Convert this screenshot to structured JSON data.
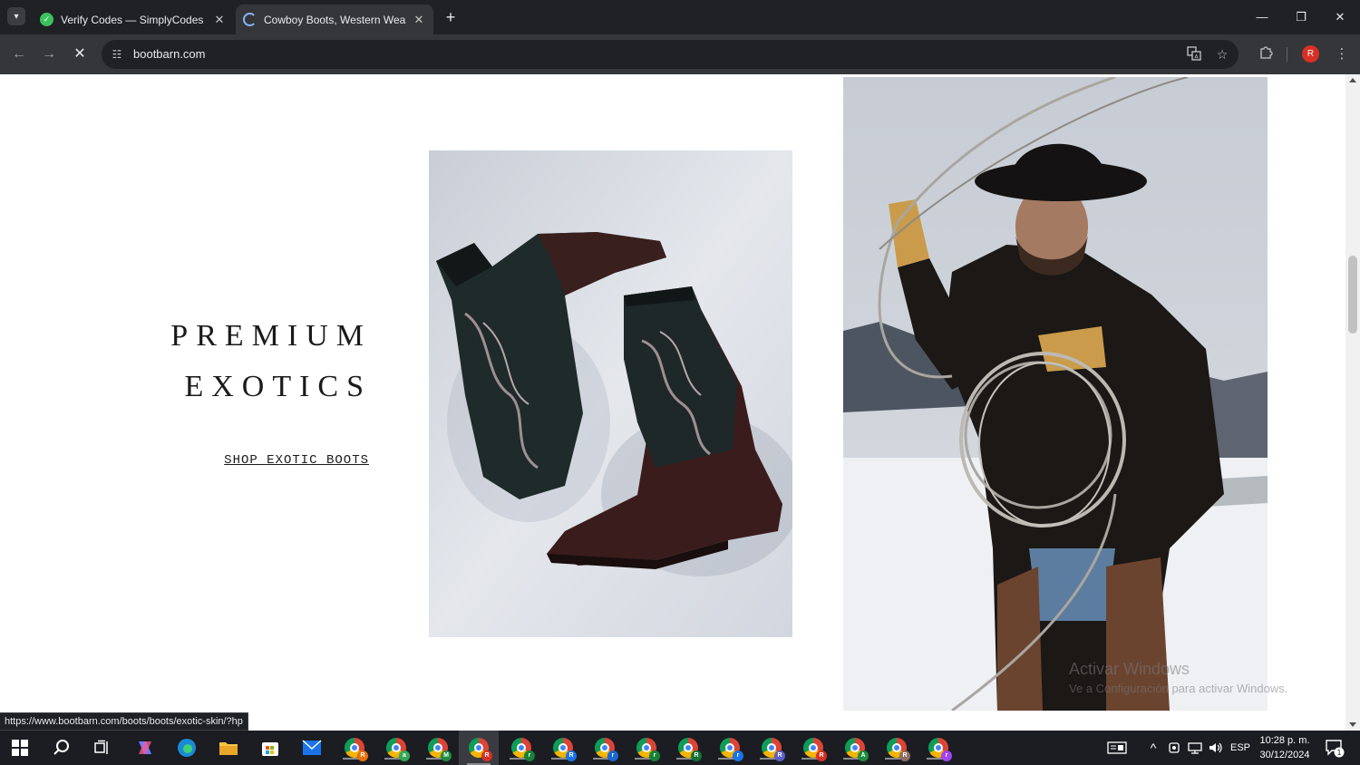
{
  "browser": {
    "tabs": [
      {
        "title": "Verify Codes — SimplyCodes",
        "active": false
      },
      {
        "title": "Cowboy Boots, Western Wear &",
        "active": true
      }
    ],
    "address": "bootbarn.com",
    "profile_initial": "R",
    "status_url": "https://www.bootbarn.com/boots/boots/exotic-skin/?hp"
  },
  "page": {
    "headline_line1": "PREMIUM",
    "headline_line2": "EXOTICS",
    "cta_label": "SHOP EXOTIC BOOTS",
    "watermark_line1": "Activar Windows",
    "watermark_line2": "Ve a Configuración para activar Windows."
  },
  "taskbar": {
    "language": "ESP",
    "time": "10:28 p. m.",
    "date": "30/12/2024",
    "notifications": "1",
    "chrome_badges": [
      {
        "letter": "R",
        "color": "#e8710a"
      },
      {
        "letter": "a",
        "color": "#34a853"
      },
      {
        "letter": "M",
        "color": "#1e8e3e"
      },
      {
        "letter": "R",
        "color": "#d93025"
      },
      {
        "letter": "r",
        "color": "#188038"
      },
      {
        "letter": "R",
        "color": "#1a73e8"
      },
      {
        "letter": "r",
        "color": "#1967d2"
      },
      {
        "letter": "r",
        "color": "#188038"
      },
      {
        "letter": "R",
        "color": "#137333"
      },
      {
        "letter": "r",
        "color": "#1a73e8"
      },
      {
        "letter": "R",
        "color": "#5b5fc7"
      },
      {
        "letter": "R",
        "color": "#d93025"
      },
      {
        "letter": "A",
        "color": "#1e8e3e"
      },
      {
        "letter": "R",
        "color": "#8d6e63"
      },
      {
        "letter": "r",
        "color": "#a142f4"
      }
    ]
  }
}
